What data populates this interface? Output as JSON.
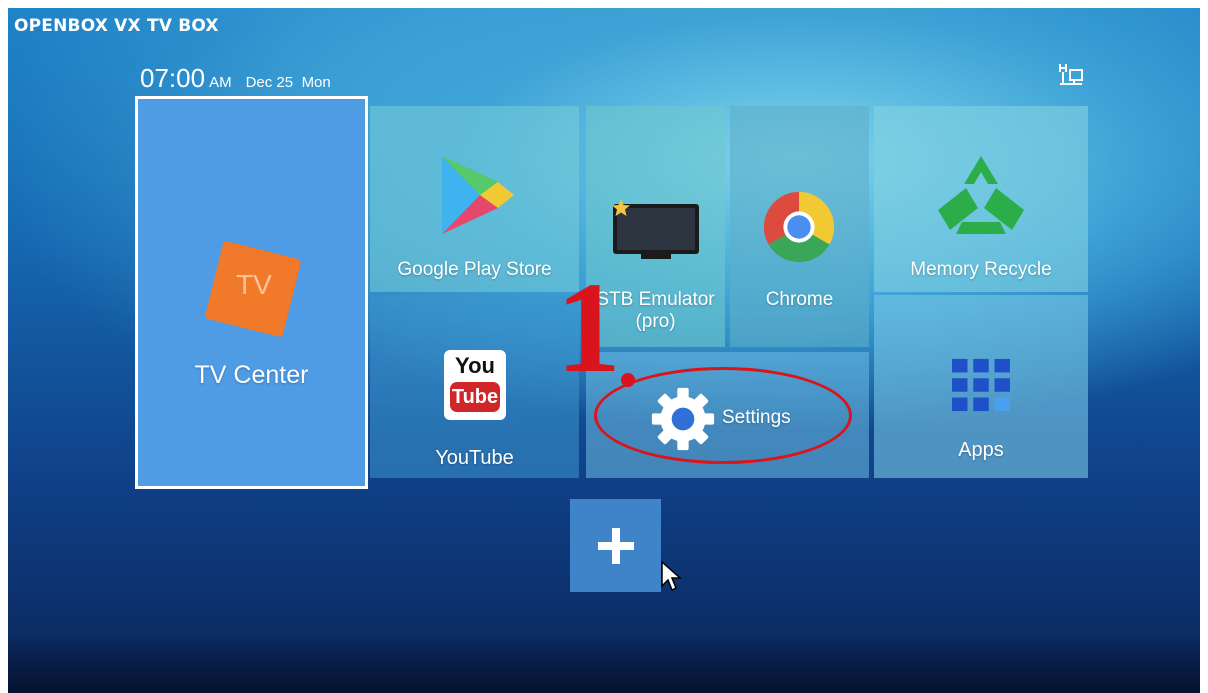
{
  "brand": "OPENBOX VX TV BOX",
  "status_bar": {
    "time": "07:00",
    "ampm": "AM",
    "date": "Dec 25",
    "weekday": "Mon",
    "network_icon": "ethernet-icon"
  },
  "tiles": {
    "tv_center": {
      "label": "TV Center",
      "icon_text": "TV",
      "icon": "tv-center-icon"
    },
    "google_play": {
      "label": "Google Play Store",
      "icon": "google-play-icon"
    },
    "youtube": {
      "label": "YouTube",
      "icon_top": "You",
      "icon_bottom": "Tube",
      "icon": "youtube-icon"
    },
    "stb_emulator": {
      "label_line1": "STB Emulator",
      "label_line2": "(pro)",
      "icon": "tv-screen-icon"
    },
    "chrome": {
      "label": "Chrome",
      "icon": "chrome-icon"
    },
    "settings": {
      "label": "Settings",
      "icon": "gear-icon"
    },
    "memory_recycle": {
      "label": "Memory Recycle",
      "icon": "recycle-icon"
    },
    "apps": {
      "label": "Apps",
      "icon": "grid-icon"
    },
    "add": {
      "icon": "plus-icon"
    }
  },
  "annotation": {
    "step_number": "1"
  },
  "colors": {
    "accent_red": "#d9141c",
    "tv_center_tile": "#4f9be4",
    "tv_icon_orange": "#f07a2a",
    "apps_grid_blue": "#1f4fc9"
  }
}
